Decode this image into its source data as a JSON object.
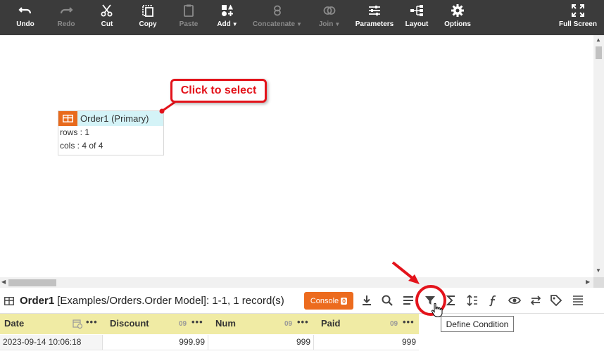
{
  "toolbar": {
    "undo": "Undo",
    "redo": "Redo",
    "cut": "Cut",
    "copy": "Copy",
    "paste": "Paste",
    "add": "Add",
    "concatenate": "Concatenate",
    "join": "Join",
    "parameters": "Parameters",
    "layout": "Layout",
    "options": "Options",
    "full_screen": "Full Screen"
  },
  "canvas": {
    "node": {
      "title": "Order1 (Primary)",
      "rows": "rows : 1",
      "cols": "cols : 4 of 4"
    },
    "callout": "Click to select"
  },
  "panel": {
    "table_name": "Order1",
    "table_path": "[Examples/Orders.Order Model]: 1-1, 1 record(s)",
    "console_label": "Console",
    "console_count": "0",
    "tooltip": "Define Condition"
  },
  "grid": {
    "columns": [
      {
        "name": "Date",
        "type": ""
      },
      {
        "name": "Discount",
        "type": "09"
      },
      {
        "name": "Num",
        "type": "09"
      },
      {
        "name": "Paid",
        "type": "09"
      }
    ],
    "rows": [
      [
        "2023-09-14 10:06:18",
        "999.99",
        "999",
        "999"
      ]
    ]
  },
  "colors": {
    "toolbar_bg": "#3b3b3b",
    "accent_orange": "#ec6b1e",
    "annotation_red": "#e3131b",
    "header_yellow": "#f0eba4",
    "node_header": "#d4f3f7"
  }
}
